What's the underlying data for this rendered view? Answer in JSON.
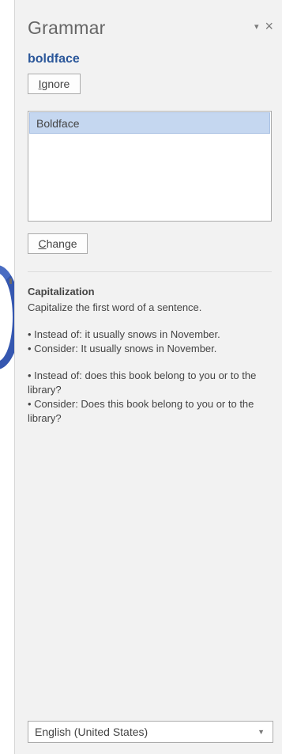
{
  "pane": {
    "title": "Grammar",
    "close_glyph": "×",
    "menu_glyph": "▾"
  },
  "flagged_word": "boldface",
  "ignore_button": {
    "underlined_char": "I",
    "rest": "gnore"
  },
  "suggestions": [
    "Boldface"
  ],
  "change_button": {
    "underlined_char": "C",
    "rest": "hange"
  },
  "explanation": {
    "rule_title": "Capitalization",
    "rule_description": "Capitalize the first word of a sentence.",
    "examples": [
      {
        "instead": "• Instead of: it usually snows in November.",
        "consider": "• Consider: It usually snows in November."
      },
      {
        "instead": "• Instead of: does this book belong to you or to the library?",
        "consider": "• Consider: Does this book belong to you or to the library?"
      }
    ]
  },
  "language": {
    "value": "English (United States)"
  },
  "colors": {
    "pane_bg": "#f2f2f2",
    "accent_blue": "#2b579a",
    "selection_bg": "#c5d7f0"
  },
  "icons": {
    "close": "close-icon",
    "pane_options": "chevron-down-icon",
    "language_dropdown": "chevron-down-icon"
  }
}
